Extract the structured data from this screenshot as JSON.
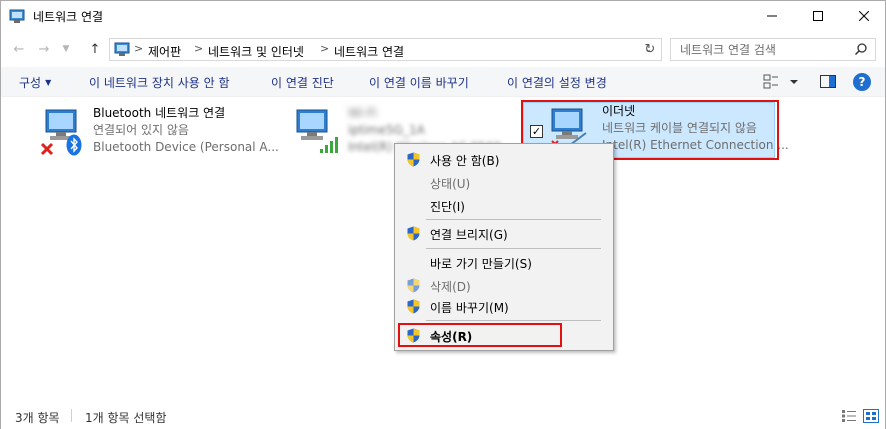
{
  "window": {
    "title": "네트워크 연결"
  },
  "address": {
    "crumbs": [
      "제어판",
      "네트워크 및 인터넷",
      "네트워크 연결"
    ],
    "search_placeholder": "네트워크 연결 검색"
  },
  "commands": {
    "organize": "구성",
    "disable_device": "이 네트워크 장치 사용 안 함",
    "diagnose": "이 연결 진단",
    "rename": "이 연결 이름 바꾸기",
    "change_settings": "이 연결의 설정 변경"
  },
  "connections": [
    {
      "name": "Bluetooth 네트워크 연결",
      "status": "연결되어 있지 않음",
      "device": "Bluetooth Device (Personal A..."
    },
    {
      "name": "Wi-Fi",
      "status": "iptime5G_1A",
      "device": "Intel(R) Wireless-AC 9560"
    },
    {
      "name": "이더넷",
      "status": "네트워크 케이블 연결되지 않음",
      "device": "Intel(R) Ethernet Connection ..."
    }
  ],
  "context_menu": [
    {
      "label": "사용 안 함(B)",
      "shield": true,
      "disabled": false,
      "bold": false
    },
    {
      "label": "상태(U)",
      "shield": false,
      "disabled": true,
      "bold": false
    },
    {
      "label": "진단(I)",
      "shield": false,
      "disabled": false,
      "bold": false
    },
    {
      "label": "연결 브리지(G)",
      "shield": true,
      "disabled": false,
      "bold": false
    },
    {
      "label": "바로 가기 만들기(S)",
      "shield": false,
      "disabled": false,
      "bold": false
    },
    {
      "label": "삭제(D)",
      "shield": true,
      "disabled": true,
      "bold": false
    },
    {
      "label": "이름 바꾸기(M)",
      "shield": true,
      "disabled": false,
      "bold": false
    },
    {
      "label": "속성(R)",
      "shield": true,
      "disabled": false,
      "bold": true
    }
  ],
  "status": {
    "count": "3개 항목",
    "selected": "1개 항목 선택함"
  },
  "colors": {
    "highlight_red": "#e4100e",
    "selection_bg": "#cce8ff",
    "command_text": "#1e3287"
  }
}
